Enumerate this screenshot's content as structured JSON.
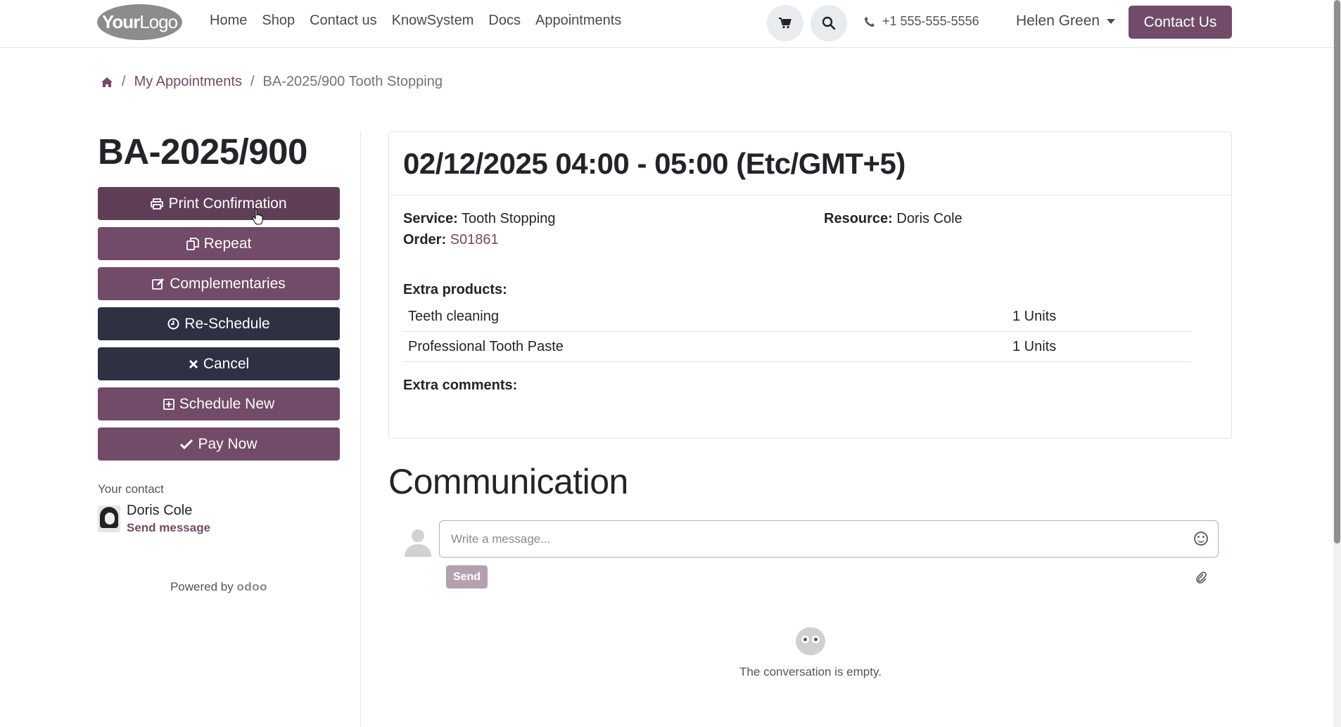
{
  "header": {
    "logo": {
      "bold": "Your",
      "light": "Logo"
    },
    "nav": [
      "Home",
      "Shop",
      "Contact us",
      "KnowSystem",
      "Docs",
      "Appointments"
    ],
    "phone": "+1 555-555-5556",
    "user": "Helen Green",
    "contact_button": "Contact Us"
  },
  "breadcrumb": {
    "items": [
      "My Appointments",
      "BA-2025/900 Tooth Stopping"
    ]
  },
  "sidebar": {
    "reference": "BA-2025/900",
    "buttons": {
      "print": "Print Confirmation",
      "repeat": "Repeat",
      "complementaries": "Complementaries",
      "reschedule": "Re-Schedule",
      "cancel": "Cancel",
      "schedule_new": "Schedule New",
      "pay_now": "Pay Now"
    },
    "your_contact_label": "Your contact",
    "contact_name": "Doris Cole",
    "send_message": "Send message",
    "powered_by": "Powered by",
    "powered_brand": "odoo"
  },
  "appointment": {
    "datetime": "02/12/2025 04:00 - 05:00 (Etc/GMT+5)",
    "service_label": "Service:",
    "service": "Tooth Stopping",
    "order_label": "Order:",
    "order": "S01861",
    "resource_label": "Resource:",
    "resource": "Doris Cole",
    "extra_products_label": "Extra products:",
    "products": [
      {
        "name": "Teeth cleaning",
        "qty": "1 Units"
      },
      {
        "name": "Professional Tooth Paste",
        "qty": "1 Units"
      }
    ],
    "extra_comments_label": "Extra comments:"
  },
  "communication": {
    "title": "Communication",
    "placeholder": "Write a message...",
    "send": "Send",
    "empty": "The conversation is empty."
  },
  "colors": {
    "primary": "#714B67",
    "secondary": "#2d3142"
  }
}
